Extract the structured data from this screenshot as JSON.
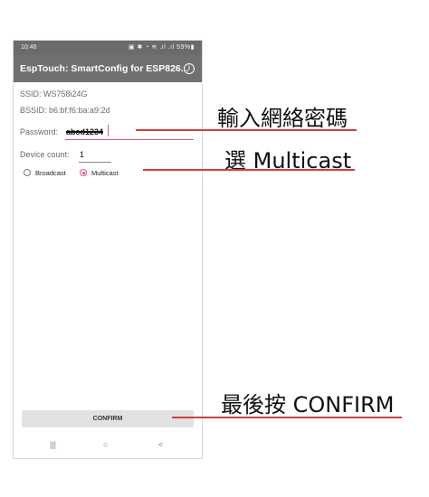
{
  "statusbar": {
    "time": "10:46",
    "icons": "▣ ✱ ◔ ≋ .ıl .ıl 59%▮"
  },
  "appbar": {
    "title": "EspTouch: SmartConfig for ESP826...",
    "info_glyph": "i"
  },
  "form": {
    "ssid": "SSID: WS758i24G",
    "bssid": "BSSID: b6:bf:f6:ba:a9:2d",
    "password_label": "Password:",
    "password_value": "abcd1234",
    "device_count_label": "Device count:",
    "device_count_value": "1"
  },
  "radios": {
    "broadcast_label": "Broadcast",
    "multicast_label": "Multicast",
    "selected": "Multicast"
  },
  "confirm_label": "CONFIRM",
  "navbar": {
    "recent_icon": "recent-apps-icon",
    "home_icon": "home-icon",
    "back_icon": "back-icon",
    "recent": "|||",
    "home": "○",
    "back": "<"
  },
  "annotations": {
    "password": "輸入網絡密碼",
    "multicast": "選 Multicast",
    "confirm": "最後按 CONFIRM"
  },
  "colors": {
    "accent": "#e0577b",
    "appbar": "#707070",
    "annotation_line": "#d23f3f"
  }
}
